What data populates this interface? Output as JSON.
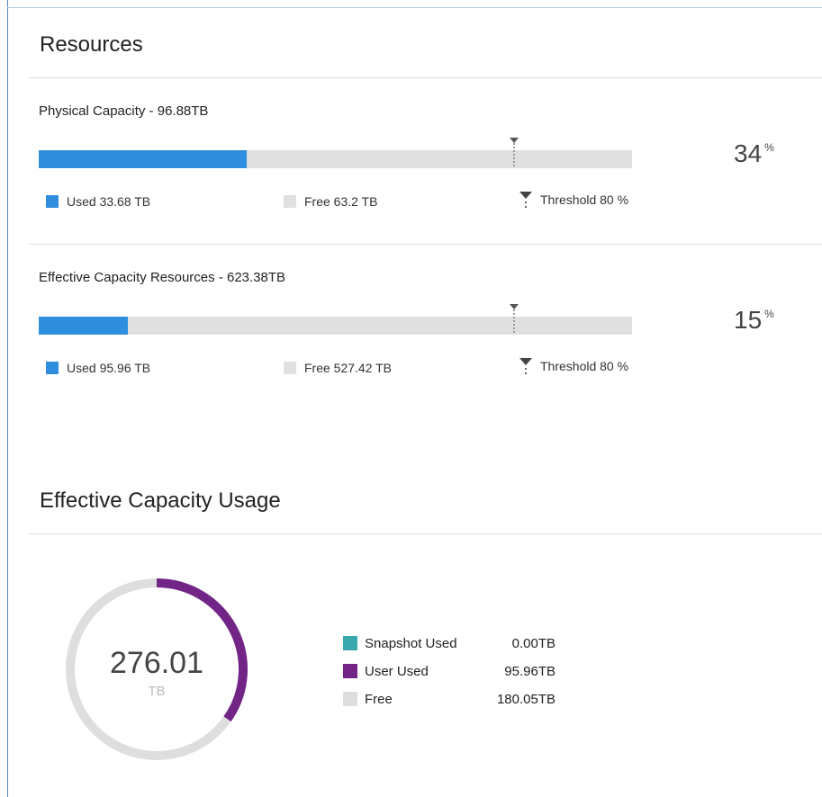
{
  "resources": {
    "title": "Resources",
    "physical": {
      "label": "Physical Capacity",
      "total": " - 96.88TB",
      "used_fraction": 0.35,
      "threshold_fraction": 0.8,
      "percent": "34",
      "percent_unit": "%",
      "legend_used": "Used 33.68 TB",
      "legend_free": "Free 63.2 TB",
      "legend_threshold": "Threshold 80 %"
    },
    "effective": {
      "label": "Effective Capacity Resources",
      "total": " - 623.38TB",
      "used_fraction": 0.15,
      "threshold_fraction": 0.8,
      "percent": "15",
      "percent_unit": "%",
      "legend_used": "Used 95.96 TB",
      "legend_free": "Free 527.42 TB",
      "legend_threshold": "Threshold 80 %"
    },
    "colors": {
      "used": "#2f8fde",
      "free": "#e0e0e0"
    }
  },
  "usage": {
    "title": "Effective Capacity Usage",
    "total_value": "276.01",
    "total_unit": "TB",
    "legend": [
      {
        "label": "Snapshot Used",
        "value": "0.00TB",
        "color": "#3aa9ad",
        "amount": 0.0
      },
      {
        "label": "User Used",
        "value": "95.96TB",
        "color": "#732587",
        "amount": 95.96
      },
      {
        "label": "Free",
        "value": "180.05TB",
        "color": "#dedede",
        "amount": 180.05
      }
    ]
  }
}
